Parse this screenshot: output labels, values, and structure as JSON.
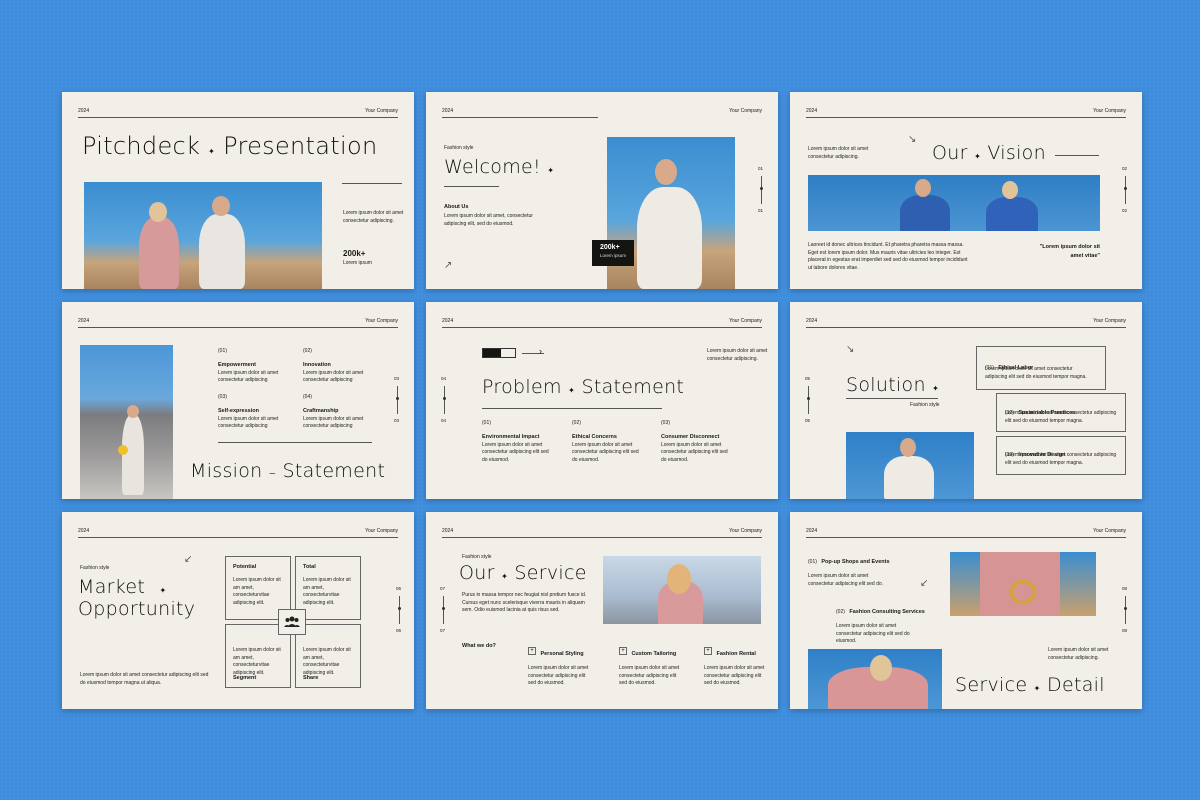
{
  "meta": {
    "year": "2024",
    "company": "Your Company"
  },
  "s1": {
    "title_a": "Pitchdeck",
    "title_b": "Presentation",
    "desc": "Lorem ipsum dolor sit amet consectetur adipiscing.",
    "stat": "200k+",
    "stat_label": "Lorem ipsum"
  },
  "s2": {
    "tag": "Fashion style",
    "title": "Welcome!",
    "about": "About Us",
    "desc": "Lorem ipsum dolor sit amet, consectetur adipiscing elit, sed do eiusmod.",
    "stat": "200k+",
    "stat_label": "Lorem ipsum",
    "n1": "01",
    "n2": "01"
  },
  "s3": {
    "desc_top": "Lorem ipsum dolor sit amet consectetur adipiscing.",
    "title_a": "Our",
    "title_b": "Vision",
    "n1": "02",
    "n2": "02",
    "desc_bottom": "Laoreet id donec ultrices tincidunt. Et pharetra pharetra massa massa. Eget est lorem ipsum dolor. Mus mauris vitae ultricies leo integer. Est placerat in egestas erat imperdiet sed sed do eiusmod tempor incididunt ut labore dolores vitae.",
    "quote": "\"Lorem ipsum dolor sit amet vitae\""
  },
  "s4": {
    "items": [
      {
        "num": "(01)",
        "title": "Empowerment",
        "desc": "Lorem ipsum dolor sit amet consectetur adipiscing"
      },
      {
        "num": "(02)",
        "title": "Innovation",
        "desc": "Lorem ipsum dolor sit amet consectetur adipiscing"
      },
      {
        "num": "(03)",
        "title": "Self-expression",
        "desc": "Lorem ipsum dolor sit amet consectetur adipiscing"
      },
      {
        "num": "(04)",
        "title": "Craftmanship",
        "desc": "Lorem ipsum dolor sit amet consectetur adipiscing"
      }
    ],
    "n1": "03",
    "n2": "03",
    "title_a": "Mission",
    "title_b": "Statement"
  },
  "s5": {
    "desc": "Lorem ipsum dolor sit amet consectetur adipiscing.",
    "title_a": "Problem",
    "title_b": "Statement",
    "n1": "04",
    "n2": "04",
    "items": [
      {
        "num": "(01)",
        "title": "Environmental Impact",
        "desc": "Lorem ipsum dolor sit amet consectetur adipiscing elit sed do eiusmod."
      },
      {
        "num": "(02)",
        "title": "Ethical Concerns",
        "desc": "Lorem ipsum dolor sit amet consectetur adipiscing elit sed do eiusmod."
      },
      {
        "num": "(03)",
        "title": "Consumer Disconnect",
        "desc": "Lorem ipsum dolor sit amet consectetur adipiscing elit sed do eiusmod."
      }
    ]
  },
  "s6": {
    "title": "Solution",
    "tag": "Fashion style",
    "n1": "05",
    "n2": "05",
    "items": [
      {
        "num": "(01)",
        "title": "Ethical Labor",
        "desc": "Lorem ipsum dolor sit amet consectetur adipiscing elit sed do eiusmod tempor magna."
      },
      {
        "num": "(02)",
        "title": "Sustainable Practices",
        "desc": "Lorem ipsum dolor sit amet consectetur adipiscing elit sed do eiusmod tempor magna."
      },
      {
        "num": "(03)",
        "title": "Innovative Design",
        "desc": "Lorem ipsum dolor sit amet consectetur adipiscing elit sed do eiusmod tempor magna."
      }
    ]
  },
  "s7": {
    "tag": "Fashion style",
    "title_a": "Market",
    "title_b": "Opportunity",
    "desc": "Lorem ipsum dolor sit amet consectetur adipiscing elit sed do eiusmod tempor magna ut aliqua.",
    "n1": "06",
    "n2": "06",
    "cells": [
      {
        "title": "Potential",
        "desc": "Lorem ipsum dolor sit am amet, consecteturvitae adipiscing elit."
      },
      {
        "title": "Total",
        "desc": "Lorem ipsum dolor sit am amet, consecteturvitae adipiscing elit."
      },
      {
        "title": "Segment",
        "desc": "Lorem ipsum dolor sit am amet, consecteturvitae adipiscing elit."
      },
      {
        "title": "Share",
        "desc": "Lorem ipsum dolor sit am amet, consecteturvitae adipiscing elit."
      }
    ]
  },
  "s8": {
    "tag": "Fashion style",
    "title_a": "Our",
    "title_b": "Service",
    "desc": "Purus in massa tempor nec feugiat nisl pretium fusce id. Cursus eget nunc scelerisque viverra mauris in aliquam sem. Odio euismod lacinia at quis risus sed.",
    "n1": "07",
    "n2": "07",
    "what": "What we do?",
    "services": [
      {
        "title": "Personal Styling",
        "desc": "Lorem ipsum dolor sit amet consectetur adipiscing elit sed do eiusmod."
      },
      {
        "title": "Custom Tailoring",
        "desc": "Lorem ipsum dolor sit amet consectetur adipiscing elit sed do eiusmod."
      },
      {
        "title": "Fashion Rental",
        "desc": "Lorem ipsum dolor sit amet consectetur adipiscing elit sed do eiusmod."
      }
    ]
  },
  "s9": {
    "items": [
      {
        "num": "(01)",
        "title": "Pop-up Shops and Events",
        "desc": "Lorem ipsum dolor sit amet consectetur adipiscing elit sed do."
      },
      {
        "num": "(02)",
        "title": "Fashion Consulting Services",
        "desc": "Lorem ipsum dolor sit amet consectetur adipiscing elit sed do eiusmod."
      }
    ],
    "n1": "08",
    "n2": "08",
    "desc": "Lorem ipsum dolor sit amet consectetur adipiscing.",
    "title_a": "Service",
    "title_b": "Detail"
  },
  "star": "✦",
  "colors": {
    "background": "#3f8ede",
    "slide": "#f2eee8",
    "ink": "#111111"
  }
}
